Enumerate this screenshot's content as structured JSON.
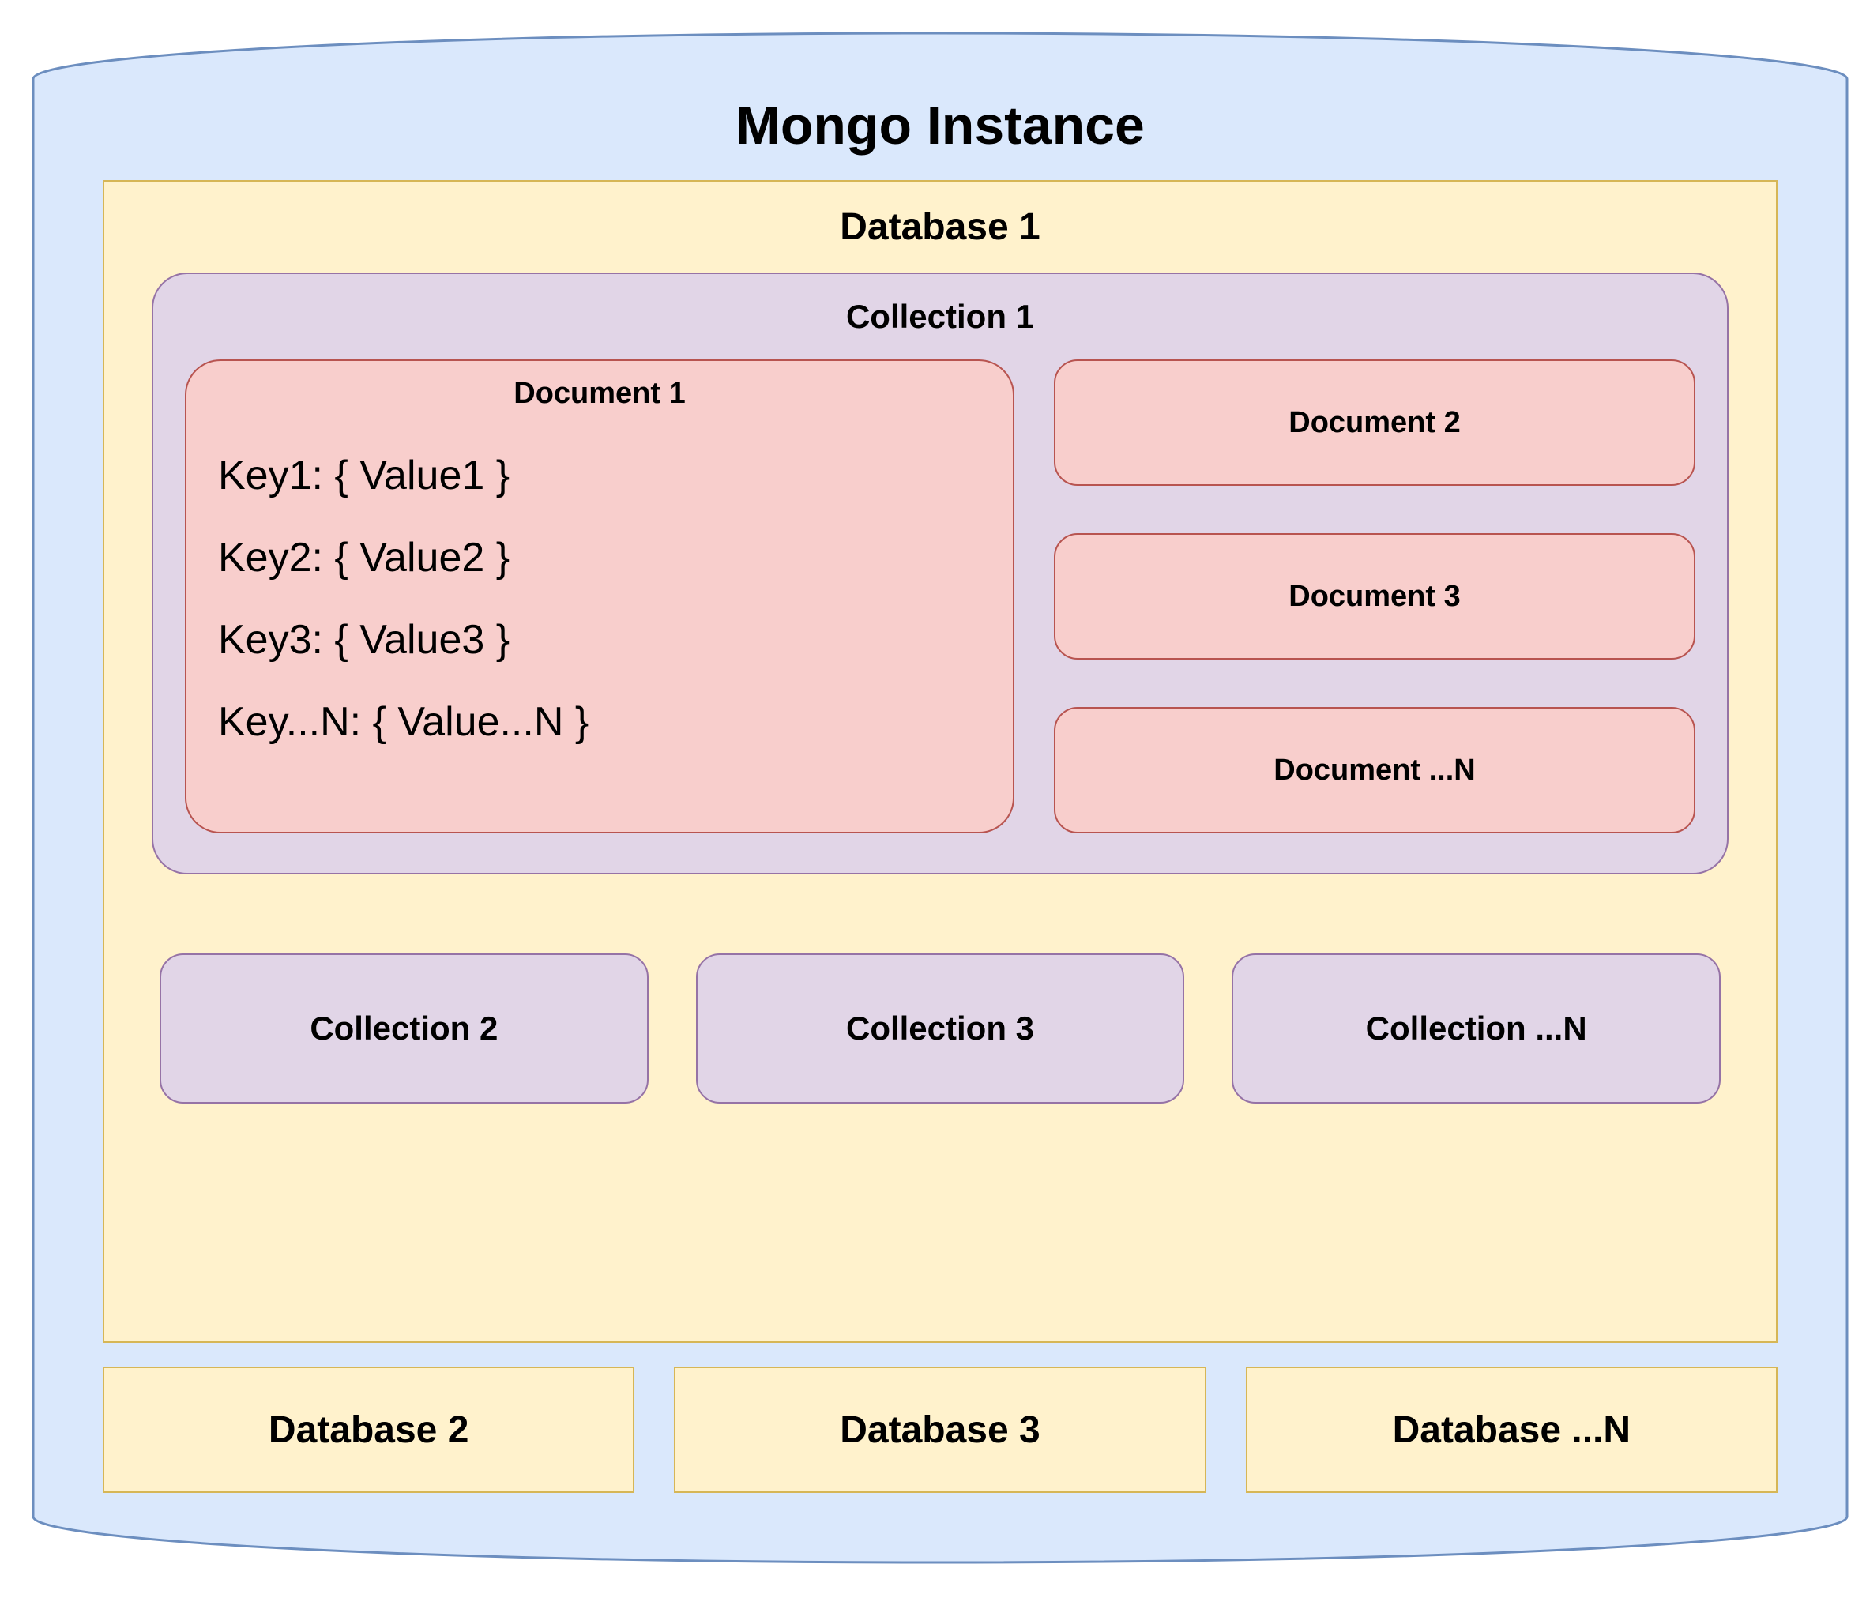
{
  "instance": {
    "title": "Mongo Instance",
    "database1": {
      "title": "Database 1",
      "collection1": {
        "title": "Collection 1",
        "document1": {
          "title": "Document 1",
          "pairs": [
            "Key1: { Value1 }",
            "Key2: { Value2 }",
            "Key3: { Value3 }",
            "Key...N: { Value...N }"
          ]
        },
        "other_documents": [
          "Document 2",
          "Document 3",
          "Document ...N"
        ]
      },
      "other_collections": [
        "Collection 2",
        "Collection 3",
        "Collection ...N"
      ]
    },
    "other_databases": [
      "Database 2",
      "Database 3",
      "Database ...N"
    ]
  },
  "colors": {
    "cylinder_fill": "#dae8fc",
    "cylinder_stroke": "#6c8ebf",
    "database_fill": "#fff2cc",
    "database_stroke": "#d6b656",
    "collection_fill": "#e1d5e7",
    "collection_stroke": "#9673a6",
    "document_fill": "#f8cecc",
    "document_stroke": "#b85450"
  }
}
